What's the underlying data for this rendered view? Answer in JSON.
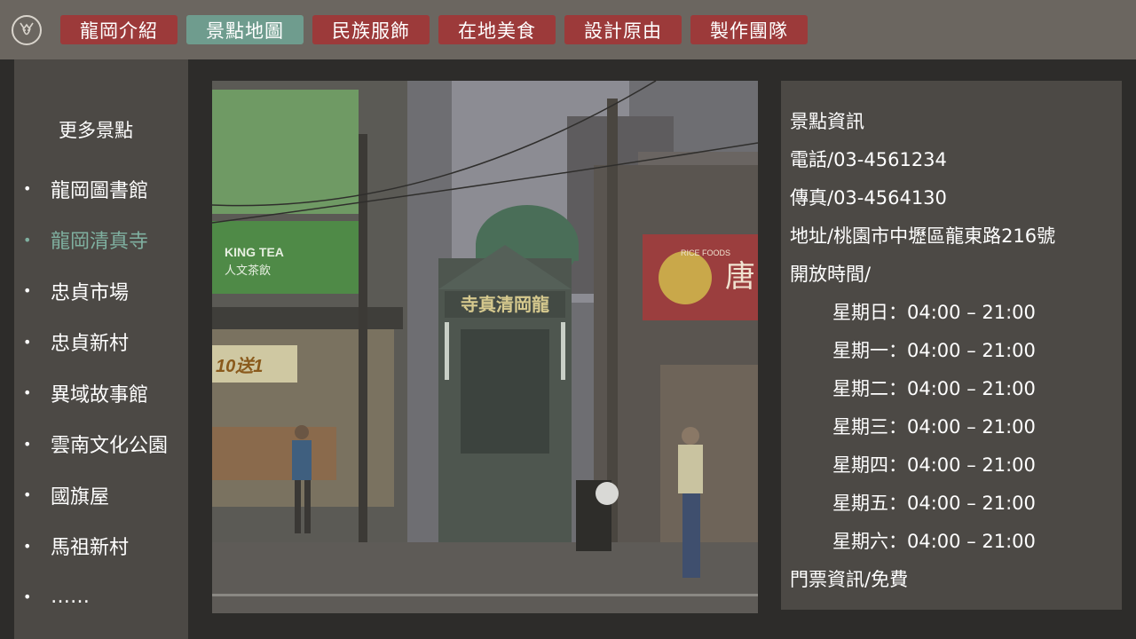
{
  "nav": {
    "items": [
      {
        "label": "龍岡介紹",
        "active": false
      },
      {
        "label": "景點地圖",
        "active": true
      },
      {
        "label": "民族服飾",
        "active": false
      },
      {
        "label": "在地美食",
        "active": false
      },
      {
        "label": "設計原由",
        "active": false
      },
      {
        "label": "製作團隊",
        "active": false
      }
    ]
  },
  "sidebar": {
    "title": "更多景點",
    "items": [
      {
        "label": "龍岡圖書館",
        "active": false
      },
      {
        "label": "龍岡清真寺",
        "active": true
      },
      {
        "label": "忠貞市場",
        "active": false
      },
      {
        "label": "忠貞新村",
        "active": false
      },
      {
        "label": "異域故事館",
        "active": false
      },
      {
        "label": "雲南文化公園",
        "active": false
      },
      {
        "label": "國旗屋",
        "active": false
      },
      {
        "label": "馬祖新村",
        "active": false
      },
      {
        "label": "……",
        "active": false
      }
    ]
  },
  "photo": {
    "signs": {
      "mosque": "寺真清岡龍",
      "shop_left": "KING TEA",
      "shop_left_sub": "人文茶飲",
      "promo": "10送1",
      "shop_right": "RICE FOODS",
      "shop_right_char": "唐"
    }
  },
  "info": {
    "heading": "景點資訊",
    "phone": "電話/03-4561234",
    "fax": "傳真/03-4564130",
    "address": "地址/桃園市中壢區龍東路216號",
    "hours_label": "開放時間/",
    "hours": [
      "星期日：04:00 – 21:00",
      "星期一：04:00 – 21:00",
      "星期二：04:00 – 21:00",
      "星期三：04:00 – 21:00",
      "星期四：04:00 – 21:00",
      "星期五：04:00 – 21:00",
      "星期六：04:00 – 21:00"
    ],
    "ticket": "門票資訊/免費"
  },
  "colors": {
    "topbar": "#6b6660",
    "nav_button": "#9c3a3a",
    "nav_active": "#6f9c8e",
    "panel": "#4c4945",
    "background": "#2d2c2a",
    "sidebar_active_text": "#7fb0a0"
  }
}
